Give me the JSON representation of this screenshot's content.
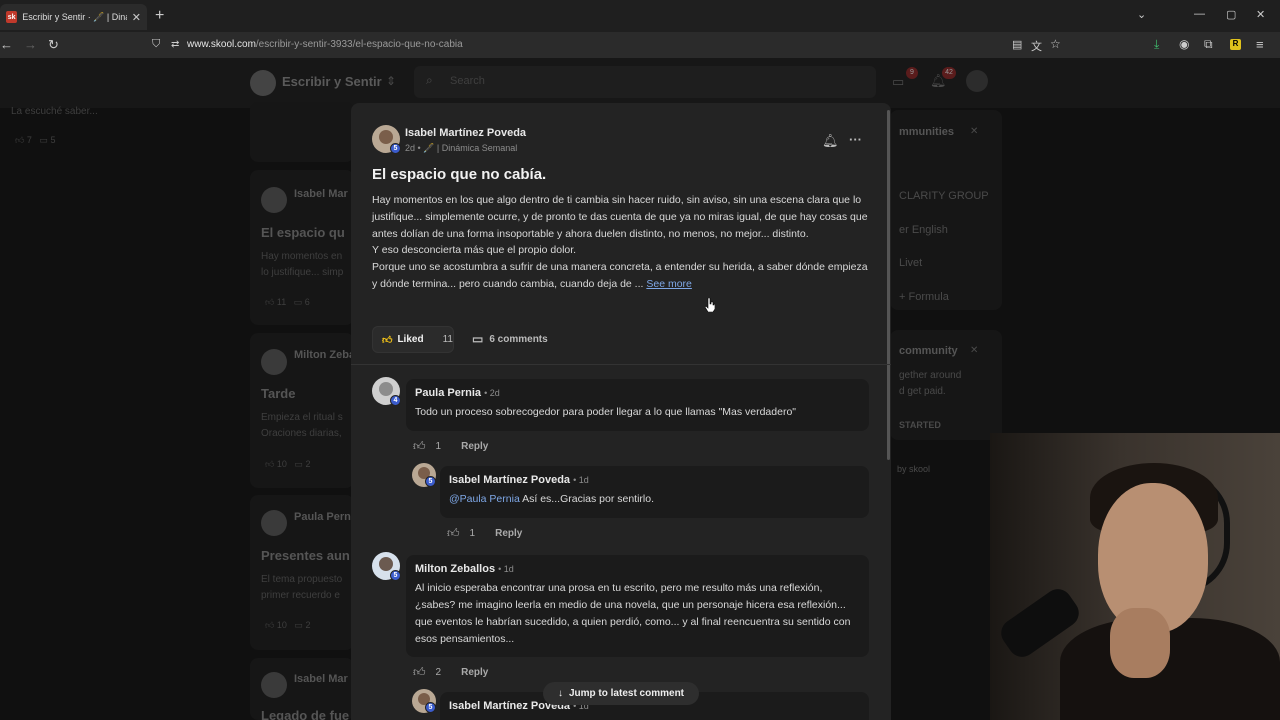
{
  "browser": {
    "tab_title": "Escribir y Sentir · 🖋️ | Dinámica",
    "favicon_text": "sk",
    "url_domain": "www.skool.com",
    "url_path": "/escribir-y-sentir-3933/el-espacio-que-no-cabia"
  },
  "background": {
    "group_name": "Escribir y Sentir",
    "search_placeholder": "Search",
    "feed": [
      {
        "snippet": "La escuché saber...",
        "likes": "7",
        "comments": "5"
      },
      {
        "name": "Isabel Mar",
        "title": "El espacio qu",
        "body": [
          "Hay momentos en",
          "lo justifique... simp"
        ],
        "likes": "11",
        "comments": "6"
      },
      {
        "name": "Milton Zeba",
        "title": "Tarde",
        "body": [
          "Empieza el ritual s",
          "Oraciones diarias,"
        ],
        "likes": "10",
        "comments": "2"
      },
      {
        "name": "Paula Perni",
        "title": "Presentes aun",
        "body": [
          "El tema propuesto",
          "primer recuerdo e"
        ],
        "likes": "10",
        "comments": "2"
      },
      {
        "name": "Isabel Mar",
        "title": "Legado de fue",
        "body": [],
        "likes": "",
        "comments": ""
      }
    ],
    "sidebar": {
      "header1": "mmunities",
      "items": [
        "CLARITY GROUP",
        "er English",
        "Livet",
        "+ Formula"
      ],
      "header2": "community",
      "desc": [
        "gether around",
        "d get paid."
      ],
      "cta": "STARTED",
      "powered": "by skool"
    },
    "badges": {
      "chat": "9",
      "notifications": "42"
    }
  },
  "post": {
    "author": "Isabel Martínez Poveda",
    "level": "5",
    "time": "2d",
    "category": "🖋️ | Dinámica Semanal",
    "title": "El espacio que no cabía.",
    "paragraphs": [
      "Hay momentos en los que algo dentro de ti cambia sin hacer ruido, sin aviso, sin una escena clara que lo justifique... simplemente ocurre, y de pronto te das cuenta de que ya no miras igual, de que hay cosas que antes dolían de una forma insoportable y ahora duelen distinto, no menos, no mejor... distinto.",
      "Y eso desconcierta más que el propio dolor.",
      "Porque uno se acostumbra a sufrir de una manera concreta, a entender su herida, a saber dónde empieza y dónde termina... pero cuando cambia, cuando deja de ..."
    ],
    "see_more": "See more",
    "liked_label": "Liked",
    "like_count": "11",
    "comments_label": "6 comments"
  },
  "comments": [
    {
      "author": "Paula Pernia",
      "time": "2d",
      "level": "4",
      "text": "Todo un proceso sobrecogedor para poder llegar a lo que llamas \"Mas verdadero\"",
      "likes": "1",
      "reply": "Reply"
    },
    {
      "author": "Isabel Martínez Poveda",
      "time": "1d",
      "level": "5",
      "mention": "@Paula Pernia",
      "text": " Así es...Gracias por sentirlo.",
      "likes": "1",
      "reply": "Reply"
    },
    {
      "author": "Milton Zeballos",
      "time": "1d",
      "level": "5",
      "text": "Al inicio esperaba encontrar una prosa en tu escrito, pero me resulto más una reflexión, ¿sabes? me imagino leerla en medio de una novela, que un personaje hicera esa reflexión... que eventos le habrían sucedido, a quien perdió, como... y al final reencuentra su sentido con esos pensamientos...",
      "likes": "2",
      "reply": "Reply"
    },
    {
      "author": "Isabel Martínez Poveda",
      "time": "1d",
      "level": "5"
    }
  ],
  "jump_label": "Jump to latest comment"
}
